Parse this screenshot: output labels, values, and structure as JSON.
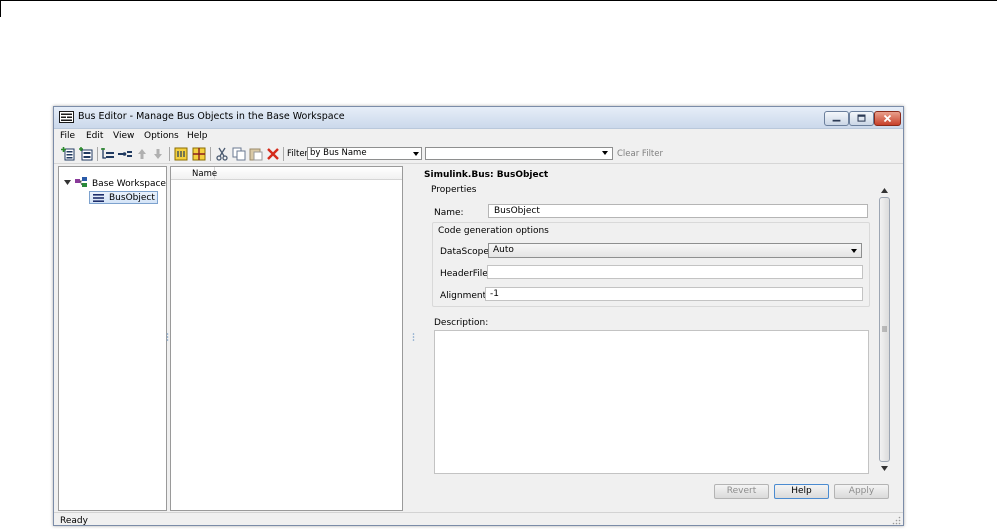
{
  "window": {
    "title": "Bus Editor - Manage Bus Objects in the Base Workspace"
  },
  "menu": {
    "items": [
      "File",
      "Edit",
      "View",
      "Options",
      "Help"
    ]
  },
  "toolbar": {
    "icons": [
      "add-bus-icon",
      "add-subbus-icon",
      "insert-element-icon",
      "delete-element-icon",
      "move-up-icon",
      "move-down-icon",
      "highlight-icon",
      "grid-icon",
      "cut-icon",
      "copy-icon",
      "paste-icon",
      "delete-icon"
    ],
    "filter_label": "Filter:",
    "filter_mode": "by Bus Name",
    "filter_text": "",
    "clear_filter": "Clear Filter"
  },
  "tree": {
    "root_label": "Base Workspace",
    "child_label": "BusObject"
  },
  "list": {
    "column_name": "Name"
  },
  "properties": {
    "title": "Simulink.Bus: BusObject",
    "group_label": "Properties",
    "name_label": "Name:",
    "name_value": "BusObject",
    "codegen_title": "Code generation options",
    "datascope_label": "DataScope:",
    "datascope_value": "Auto",
    "headerfile_label": "HeaderFile:",
    "headerfile_value": "",
    "alignment_label": "Alignment:",
    "alignment_value": "-1",
    "description_label": "Description:",
    "description_value": ""
  },
  "buttons": {
    "revert": "Revert",
    "help": "Help",
    "apply": "Apply"
  },
  "status": {
    "text": "Ready"
  },
  "colors": {
    "titlebar": "#cbd9eb",
    "selection": "#d4e4f7",
    "close_button": "#c7402a",
    "focus_button_border": "#4b8bd0"
  }
}
